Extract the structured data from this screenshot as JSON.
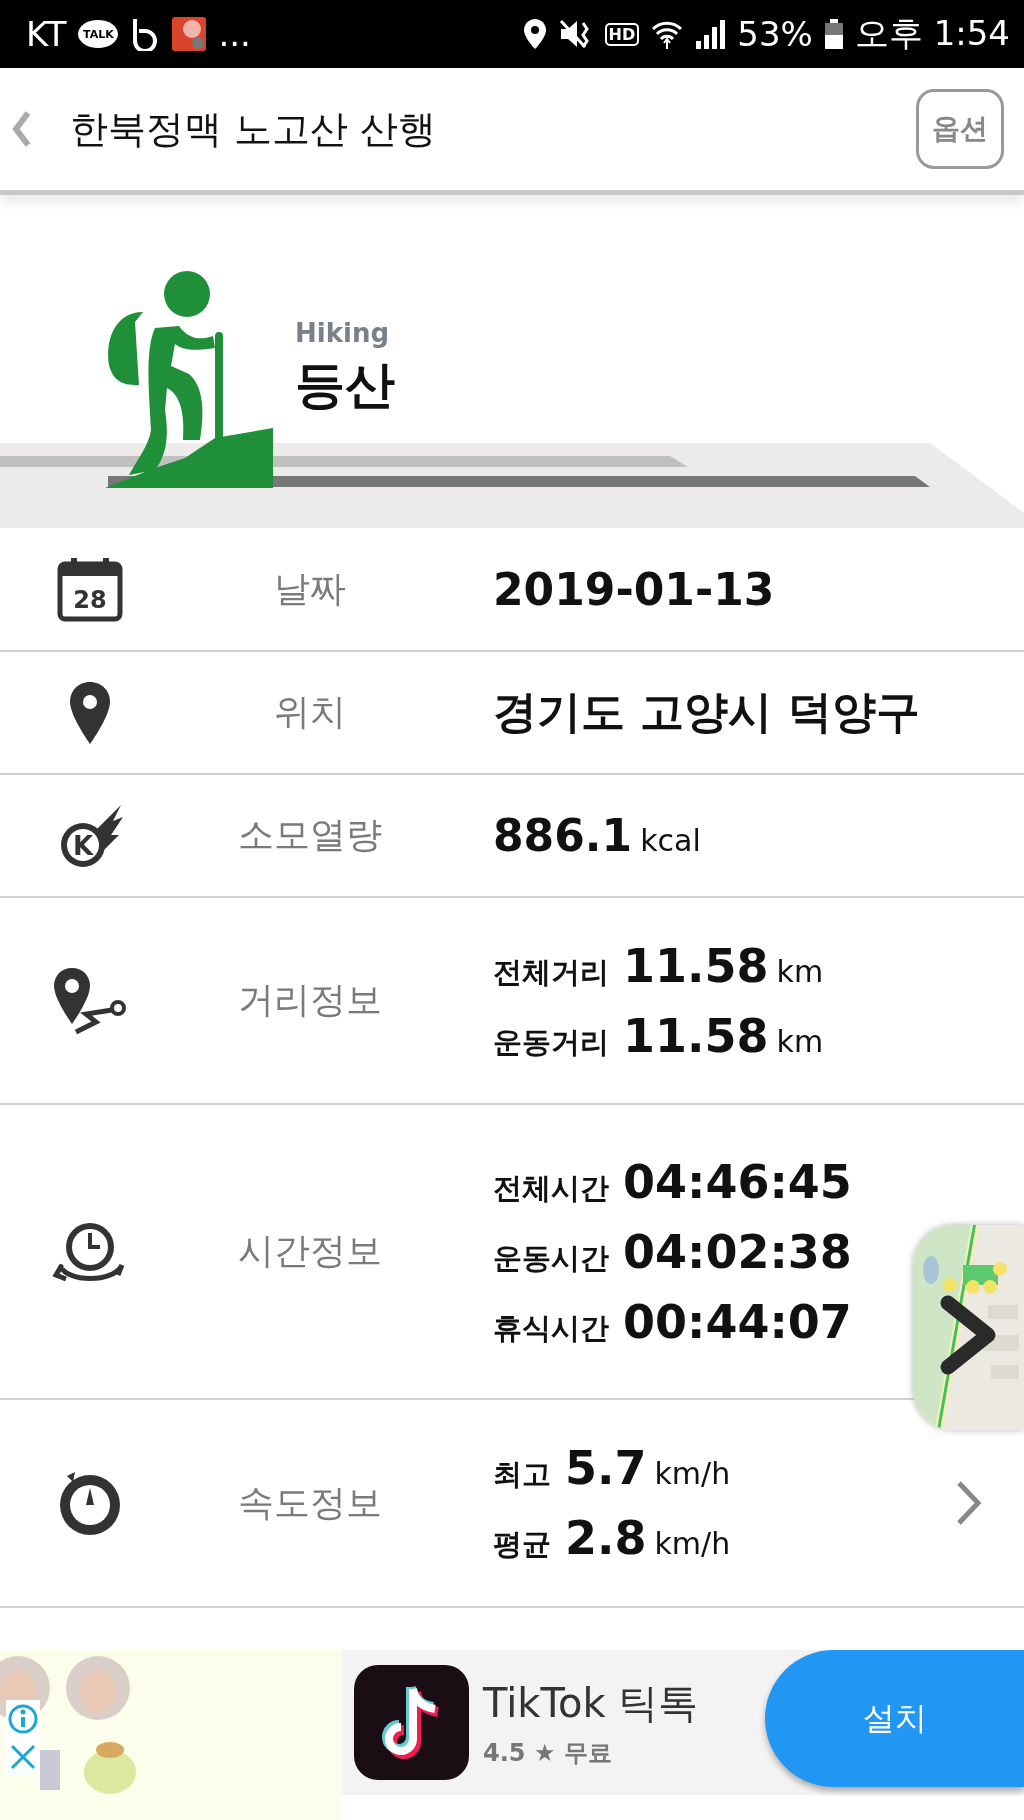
{
  "status_bar": {
    "carrier": "KT",
    "chat_badge": "TALK",
    "more": "...",
    "hd_badge": "HD",
    "battery": "53%",
    "time": "오후 1:54"
  },
  "header": {
    "title": "한북정맥 노고산 산행",
    "option_button": "옵션"
  },
  "activity": {
    "label_en": "Hiking",
    "label": "등산"
  },
  "rows": [
    {
      "kind": "date",
      "icon_text": "28",
      "label": "날짜",
      "value": "2019-01-13"
    },
    {
      "kind": "location",
      "label": "위치",
      "value": "경기도 고양시 덕양구"
    },
    {
      "kind": "calories",
      "icon_text": "K",
      "label": "소모열량",
      "value": "886.1",
      "unit": "kcal"
    },
    {
      "kind": "distance",
      "label": "거리정보",
      "lines": [
        {
          "name": "전체거리",
          "value": "11.58",
          "unit": "km"
        },
        {
          "name": "운동거리",
          "value": "11.58",
          "unit": "km"
        }
      ]
    },
    {
      "kind": "time",
      "label": "시간정보",
      "lines": [
        {
          "name": "전체시간",
          "value": "04:46:45"
        },
        {
          "name": "운동시간",
          "value": "04:02:38"
        },
        {
          "name": "휴식시간",
          "value": "00:44:07"
        }
      ]
    },
    {
      "kind": "speed",
      "label": "속도정보",
      "lines": [
        {
          "name": "최고",
          "value": "5.7",
          "unit": "km/h"
        },
        {
          "name": "평균",
          "value": "2.8",
          "unit": "km/h"
        }
      ]
    }
  ],
  "ad": {
    "app_name": "TikTok 틱톡",
    "rating": "4.5",
    "star": "★",
    "price": "무료",
    "install_button": "설치"
  }
}
